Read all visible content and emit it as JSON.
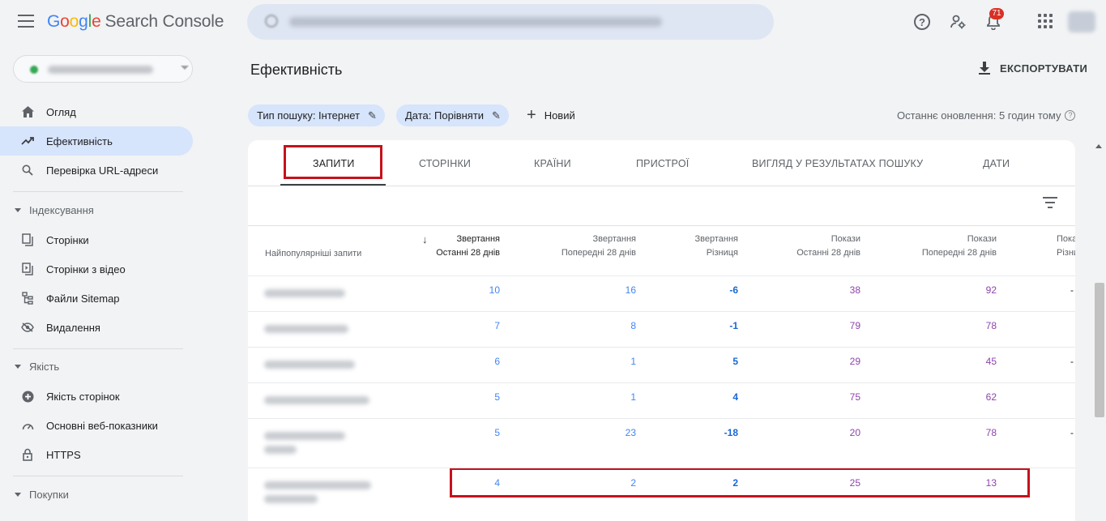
{
  "app": {
    "logo_letters": [
      "G",
      "o",
      "o",
      "g",
      "l",
      "e"
    ],
    "product_name": "Search Console",
    "notification_count": "71",
    "search_placeholder": ""
  },
  "sidebar": {
    "items": [
      {
        "label": "Огляд",
        "icon": "home-icon"
      },
      {
        "label": "Ефективність",
        "icon": "trending-up-icon",
        "active": true
      },
      {
        "label": "Перевірка URL-адреси",
        "icon": "search-icon"
      }
    ],
    "sections": [
      {
        "title": "Індексування",
        "items": [
          {
            "label": "Сторінки",
            "icon": "pages-icon"
          },
          {
            "label": "Сторінки з відео",
            "icon": "video-page-icon"
          },
          {
            "label": "Файли Sitemap",
            "icon": "sitemap-icon"
          },
          {
            "label": "Видалення",
            "icon": "removals-icon"
          }
        ]
      },
      {
        "title": "Якість",
        "items": [
          {
            "label": "Якість сторінок",
            "icon": "plus-circle-icon"
          },
          {
            "label": "Основні веб-показники",
            "icon": "speed-icon"
          },
          {
            "label": "HTTPS",
            "icon": "lock-icon"
          }
        ]
      },
      {
        "title": "Покупки",
        "items": []
      }
    ]
  },
  "main": {
    "title": "Ефективність",
    "export_label": "ЕКСПОРТУВАТИ",
    "filters": [
      {
        "label": "Тип пошуку: Інтернет"
      },
      {
        "label": "Дата: Порівняти"
      }
    ],
    "new_label": "Новий",
    "last_update": "Останнє оновлення: 5 годин тому",
    "tabs": [
      "ЗАПИТИ",
      "СТОРІНКИ",
      "КРАЇНИ",
      "ПРИСТРОЇ",
      "ВИГЛЯД У РЕЗУЛЬТАТАХ ПОШУКУ",
      "ДАТИ"
    ],
    "active_tab": "ЗАПИТИ",
    "table": {
      "first_header": "Найпопулярніші запити",
      "headers": [
        {
          "line1": "Звертання",
          "line2": "Останні 28 днів"
        },
        {
          "line1": "Звертання",
          "line2": "Попередні 28 днів"
        },
        {
          "line1": "Звертання",
          "line2": "Різниця"
        },
        {
          "line1": "Покази",
          "line2": "Останні 28 днів"
        },
        {
          "line1": "Покази",
          "line2": "Попередні 28 днів"
        },
        {
          "line1": "Пока",
          "line2": "Різни"
        }
      ],
      "rows": [
        {
          "values": [
            "10",
            "16",
            "-6",
            "38",
            "92",
            "-"
          ]
        },
        {
          "values": [
            "7",
            "8",
            "-1",
            "79",
            "78",
            ""
          ]
        },
        {
          "values": [
            "6",
            "1",
            "5",
            "29",
            "45",
            "-"
          ]
        },
        {
          "values": [
            "5",
            "1",
            "4",
            "75",
            "62",
            ""
          ]
        },
        {
          "values": [
            "5",
            "23",
            "-18",
            "20",
            "78",
            "-"
          ],
          "highlighted": true
        },
        {
          "values": [
            "4",
            "2",
            "2",
            "25",
            "13",
            ""
          ]
        }
      ]
    }
  },
  "colors": {
    "accent": "#1a73e8",
    "clicks": "#4285f4",
    "impressions": "#8e44ad",
    "highlight_box": "#c5121c",
    "active_nav": "#d6e4fc"
  }
}
